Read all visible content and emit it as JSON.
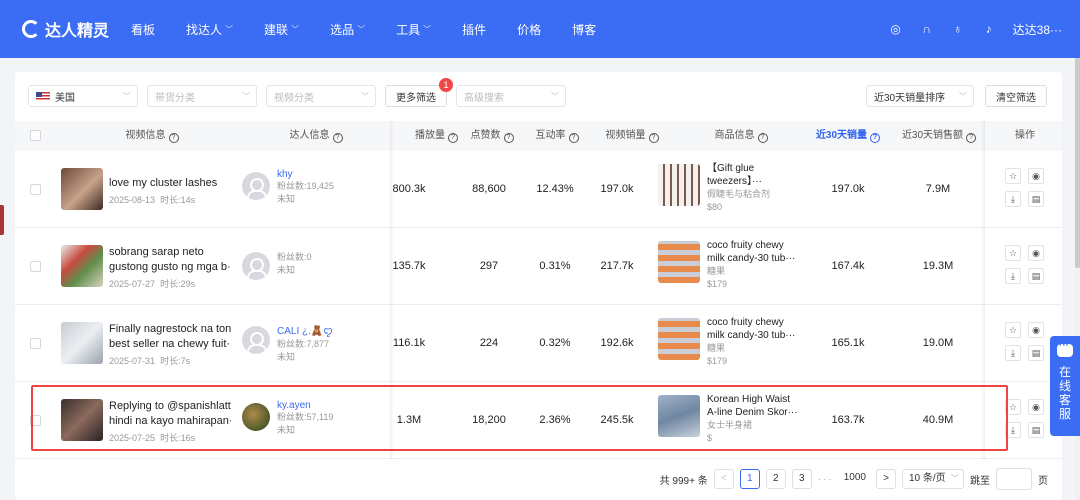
{
  "nav": {
    "brand": "达人精灵",
    "items": [
      {
        "label": "看板",
        "dropdown": false
      },
      {
        "label": "找达人",
        "dropdown": true
      },
      {
        "label": "建联",
        "dropdown": true
      },
      {
        "label": "选品",
        "dropdown": true
      },
      {
        "label": "工具",
        "dropdown": true
      },
      {
        "label": "插件",
        "dropdown": false
      },
      {
        "label": "价格",
        "dropdown": false
      },
      {
        "label": "博客",
        "dropdown": false
      }
    ],
    "user": "达达38···",
    "right_icons": [
      "globe-icon",
      "headset-icon",
      "bulb-icon",
      "bell-icon"
    ]
  },
  "filters": {
    "country": "美国",
    "category_placeholder": "带货分类",
    "video_category_placeholder": "视频分类",
    "more_filters": "更多筛选",
    "more_filters_badge": "1",
    "advanced_search_placeholder": "高级搜索",
    "sort": "近30天销量排序",
    "clear": "清空筛选"
  },
  "table": {
    "headers": {
      "video": "视频信息",
      "influencer": "达人信息",
      "plays": "播放量",
      "likes": "点赞数",
      "engagement": "互动率",
      "video_sales": "视频销量",
      "product": "商品信息",
      "sales_30d": "近30天销量",
      "revenue_30d": "近30天销售额",
      "actions": "操作"
    },
    "rows": [
      {
        "video_title": "love my cluster lashes",
        "video_title2": "",
        "date": "2025-08-13",
        "duration": "时长:14s",
        "kol_name": "khy",
        "fans": "粉丝数:19,425",
        "region": "未知",
        "plays": "800.3k",
        "likes": "88,600",
        "engagement": "12.43%",
        "video_sales": "197.0k",
        "product_title": "【Gift glue",
        "product_title2": "tweezers】···",
        "product_cat": "假睫毛与粘合剂",
        "price": "$80",
        "sales_30d": "197.0k",
        "revenue_30d": "7.9M"
      },
      {
        "video_title": "sobrang sarap neto",
        "video_title2": "gustong gusto ng mga b···",
        "date": "2025-07-27",
        "duration": "时长:29s",
        "kol_name": "",
        "fans": "粉丝数:0",
        "region": "未知",
        "plays": "135.7k",
        "likes": "297",
        "engagement": "0.31%",
        "video_sales": "217.7k",
        "product_title": "coco fruity chewy",
        "product_title2": "milk candy-30 tub···",
        "product_cat": "糖果",
        "price": "$179",
        "sales_30d": "167.4k",
        "revenue_30d": "19.3M"
      },
      {
        "video_title": "Finally nagrestock na tong",
        "video_title2": "best seller na chewy fuit···",
        "date": "2025-07-31",
        "duration": "时长:7s",
        "kol_name": "CALI ¿.🧸ꨄ",
        "fans": "粉丝数:7,877",
        "region": "未知",
        "plays": "116.1k",
        "likes": "224",
        "engagement": "0.32%",
        "video_sales": "192.6k",
        "product_title": "coco fruity chewy",
        "product_title2": "milk candy-30 tub···",
        "product_cat": "糖果",
        "price": "$179",
        "sales_30d": "165.1k",
        "revenue_30d": "19.0M"
      },
      {
        "video_title": "Replying to @spanishlatte",
        "video_title2": "hindi na kayo mahirapan···",
        "date": "2025-07-25",
        "duration": "时长:16s",
        "kol_name": "ky.ayen",
        "fans": "粉丝数:57,119",
        "region": "未知",
        "plays": "1.3M",
        "likes": "18,200",
        "engagement": "2.36%",
        "video_sales": "245.5k",
        "product_title": "Korean High Waist",
        "product_title2": "A-line Denim Skor···",
        "product_cat": "女士半身裙",
        "price": "$",
        "sales_30d": "163.7k",
        "revenue_30d": "40.9M"
      }
    ]
  },
  "pagination": {
    "total": "共 999+ 条",
    "prev": "<",
    "pages": [
      "1",
      "2",
      "3"
    ],
    "dots": "···",
    "last": "1000",
    "next": ">",
    "page_size": "10 条/页",
    "jump_label": "跳至",
    "page_unit": "页"
  },
  "support": {
    "label": "在线客服"
  }
}
